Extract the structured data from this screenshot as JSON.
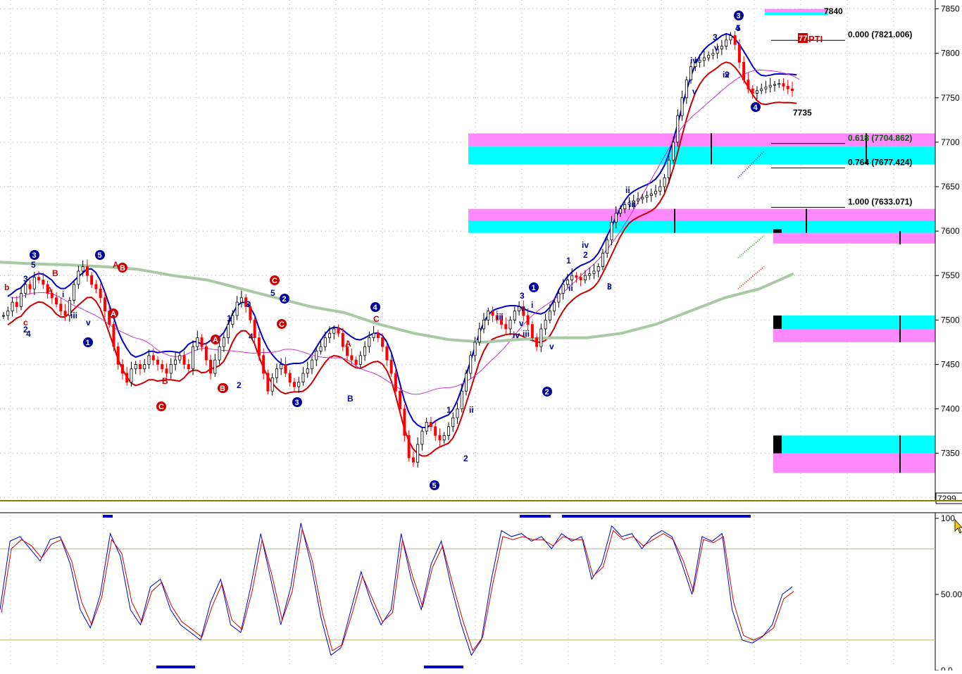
{
  "chart_data": [
    {
      "type": "candlestick",
      "panel": "price",
      "ylim": [
        7299,
        7860
      ],
      "yticks": [
        7300,
        7350,
        7400,
        7450,
        7500,
        7550,
        7600,
        7650,
        7700,
        7750,
        7800,
        7850
      ],
      "ytick_labels": [
        "7350",
        "7400",
        "7450",
        "7500",
        "7550",
        "7600",
        "7650",
        "7700",
        "7750",
        "7800",
        "7850"
      ],
      "bottom_label": "7299.",
      "grid": true,
      "bar_count": 240,
      "close_series": [
        7505,
        7510,
        7520,
        7515,
        7530,
        7540,
        7535,
        7548,
        7545,
        7540,
        7530,
        7525,
        7518,
        7510,
        7505,
        7522,
        7540,
        7555,
        7560,
        7550,
        7540,
        7535,
        7525,
        7510,
        7495,
        7470,
        7450,
        7440,
        7430,
        7445,
        7450,
        7445,
        7450,
        7460,
        7455,
        7450,
        7445,
        7440,
        7450,
        7455,
        7460,
        7450,
        7445,
        7470,
        7480,
        7470,
        7455,
        7440,
        7455,
        7470,
        7480,
        7495,
        7505,
        7520,
        7525,
        7515,
        7500,
        7480,
        7460,
        7440,
        7420,
        7435,
        7445,
        7450,
        7440,
        7430,
        7425,
        7430,
        7440,
        7445,
        7455,
        7465,
        7470,
        7480,
        7485,
        7490,
        7485,
        7470,
        7460,
        7455,
        7450,
        7460,
        7470,
        7480,
        7485,
        7480,
        7470,
        7455,
        7440,
        7420,
        7400,
        7370,
        7345,
        7340,
        7360,
        7375,
        7385,
        7380,
        7370,
        7365,
        7370,
        7380,
        7390,
        7400,
        7420,
        7440,
        7460,
        7475,
        7490,
        7500,
        7510,
        7505,
        7500,
        7495,
        7490,
        7500,
        7510,
        7515,
        7505,
        7495,
        7480,
        7470,
        7490,
        7500,
        7510,
        7520,
        7530,
        7540,
        7545,
        7550,
        7548,
        7545,
        7550,
        7552,
        7555,
        7560,
        7575,
        7590,
        7610,
        7620,
        7625,
        7630,
        7632,
        7634,
        7636,
        7638,
        7640,
        7642,
        7645,
        7650,
        7660,
        7680,
        7700,
        7730,
        7750,
        7770,
        7785,
        7790,
        7792,
        7795,
        7798,
        7800,
        7805,
        7808,
        7815,
        7820,
        7810,
        7790,
        7770,
        7760,
        7755,
        7758,
        7760,
        7762,
        7764,
        7765,
        7766,
        7763,
        7760,
        7758
      ],
      "series": [
        {
          "name": "",
          "color": "#0000cc",
          "role": "upper-band"
        },
        {
          "name": "",
          "color": "#cc0000",
          "role": "lower-band"
        },
        {
          "name": "",
          "color": "#cc33cc",
          "role": "moving-average"
        },
        {
          "name": "",
          "color": "#a9c9a4",
          "role": "long-moving-average"
        }
      ],
      "fib_levels": [
        {
          "ratio": "0.000",
          "value": 7821.006,
          "label": "0.000 (7821.006)",
          "color": "#000000"
        },
        {
          "ratio": "0.618",
          "value": 7704.862,
          "label": "0.618 (7704.862)",
          "color": "#006600"
        },
        {
          "ratio": "0.764",
          "value": 7677.424,
          "label": "0.764 (7677.424)",
          "color": "#000000"
        },
        {
          "ratio": "1.000",
          "value": 7633.071,
          "label": "1.000 (7633.071)",
          "color": "#000000"
        }
      ],
      "annotations": [
        {
          "text": "7840",
          "value": 7840
        },
        {
          "text": "7735",
          "value": 7735
        },
        {
          "text": "PTI",
          "color": "#cc0000"
        },
        {
          "text": "77",
          "color": "#ffffff",
          "bg": "#cc0000"
        }
      ],
      "wave_labels_blue_circled": [
        "3",
        "5",
        "1",
        "2",
        "3",
        "4",
        "5",
        "1",
        "2",
        "3",
        "4"
      ],
      "wave_labels_red_circled": [
        "A",
        "B",
        "C",
        "A",
        "B",
        "C",
        "C",
        "B"
      ],
      "wave_labels_plain": [
        "3",
        "5",
        "4",
        "b",
        "c",
        "2",
        "i",
        "iii",
        "v",
        "A",
        "B",
        "A",
        "B",
        "1",
        "3",
        "4",
        "5",
        "2",
        "C",
        "A",
        "B",
        "2",
        "1",
        "ii",
        "iii",
        "iv",
        "v",
        "3",
        "v",
        "i",
        "iii",
        "iv",
        "v",
        "1",
        "ii",
        "2",
        "i",
        "ii",
        "iii",
        "iv",
        "v",
        "3",
        "5",
        "iv",
        "v",
        "4",
        "3",
        "2"
      ]
    },
    {
      "type": "line",
      "panel": "oscillator",
      "ylim": [
        0,
        100
      ],
      "yticks": [
        100,
        50,
        0
      ],
      "ytick_labels": [
        "100",
        "50.00",
        "0.0"
      ],
      "reference_lines": [
        80,
        20
      ],
      "series": [
        {
          "name": "",
          "color": "#0000cc",
          "values": [
            40,
            85,
            88,
            80,
            72,
            86,
            88,
            70,
            40,
            28,
            50,
            90,
            75,
            40,
            30,
            55,
            60,
            40,
            30,
            25,
            20,
            45,
            60,
            30,
            25,
            55,
            90,
            60,
            30,
            55,
            97,
            70,
            35,
            10,
            15,
            40,
            65,
            45,
            30,
            40,
            90,
            60,
            40,
            70,
            85,
            55,
            30,
            10,
            20,
            60,
            92,
            88,
            90,
            85,
            88,
            80,
            90,
            85,
            88,
            60,
            70,
            95,
            88,
            90,
            80,
            88,
            92,
            88,
            70,
            50,
            88,
            85,
            90,
            40,
            20,
            18,
            22,
            30,
            50,
            55
          ]
        },
        {
          "name": "",
          "color": "#cc0000",
          "values": [
            38,
            80,
            86,
            82,
            74,
            83,
            86,
            72,
            45,
            30,
            48,
            86,
            77,
            45,
            32,
            52,
            58,
            42,
            32,
            27,
            22,
            42,
            57,
            33,
            27,
            52,
            86,
            62,
            33,
            52,
            93,
            72,
            38,
            13,
            17,
            38,
            62,
            47,
            32,
            38,
            86,
            62,
            42,
            68,
            82,
            57,
            33,
            13,
            22,
            57,
            88,
            86,
            88,
            86,
            86,
            82,
            88,
            86,
            86,
            62,
            68,
            92,
            86,
            88,
            82,
            86,
            90,
            86,
            72,
            52,
            86,
            84,
            88,
            45,
            23,
            20,
            23,
            28,
            47,
            52
          ]
        }
      ],
      "markers": {
        "blue_bars_top": 4,
        "blue_bars_bottom": 2
      }
    }
  ],
  "colors": {
    "grid": "#a9a9a9",
    "magenta_zone": "#ff88ff",
    "cyan_zone": "#00ffff",
    "bull": "#000000",
    "bear": "#ff0000",
    "axis": "#000000",
    "panel_sep": "#808000",
    "ref_line": "#b5b56a",
    "wave_blue": "#000099",
    "wave_red": "#cc0000"
  },
  "cursor_icon": "cursor-arrow-icon"
}
